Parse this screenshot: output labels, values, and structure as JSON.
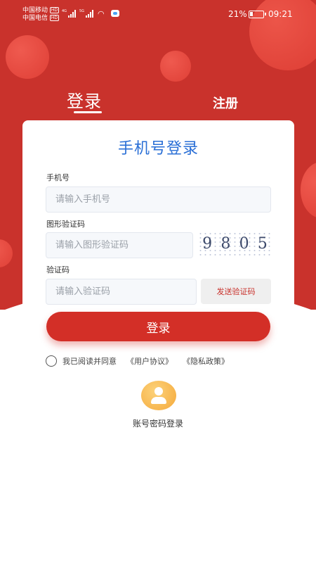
{
  "status_bar": {
    "carrier1": "中国移动",
    "carrier2": "中国电信",
    "hd": "HD",
    "net1": "4G",
    "net2": "5G",
    "battery_pct": "21%",
    "time": "09:21"
  },
  "tabs": {
    "login": "登录",
    "register": "注册"
  },
  "card": {
    "title": "手机号登录",
    "phone_label": "手机号",
    "phone_placeholder": "请输入手机号",
    "captcha_label": "图形验证码",
    "captcha_placeholder": "请输入图形验证码",
    "captcha_digits": [
      "9",
      "8",
      "0",
      "5"
    ],
    "code_label": "验证码",
    "code_placeholder": "请输入验证码",
    "send_code": "发送验证码"
  },
  "login_button": "登录",
  "agreement": {
    "text": "我已阅读并同意",
    "user_agreement": "《用户协议》",
    "privacy_policy": "《隐私政策》"
  },
  "account_login": "账号密码登录",
  "colors": {
    "brand_red": "#c9322c",
    "button_red": "#d32f27",
    "title_blue": "#2a6fd6",
    "icon_orange": "#f5a93a"
  }
}
